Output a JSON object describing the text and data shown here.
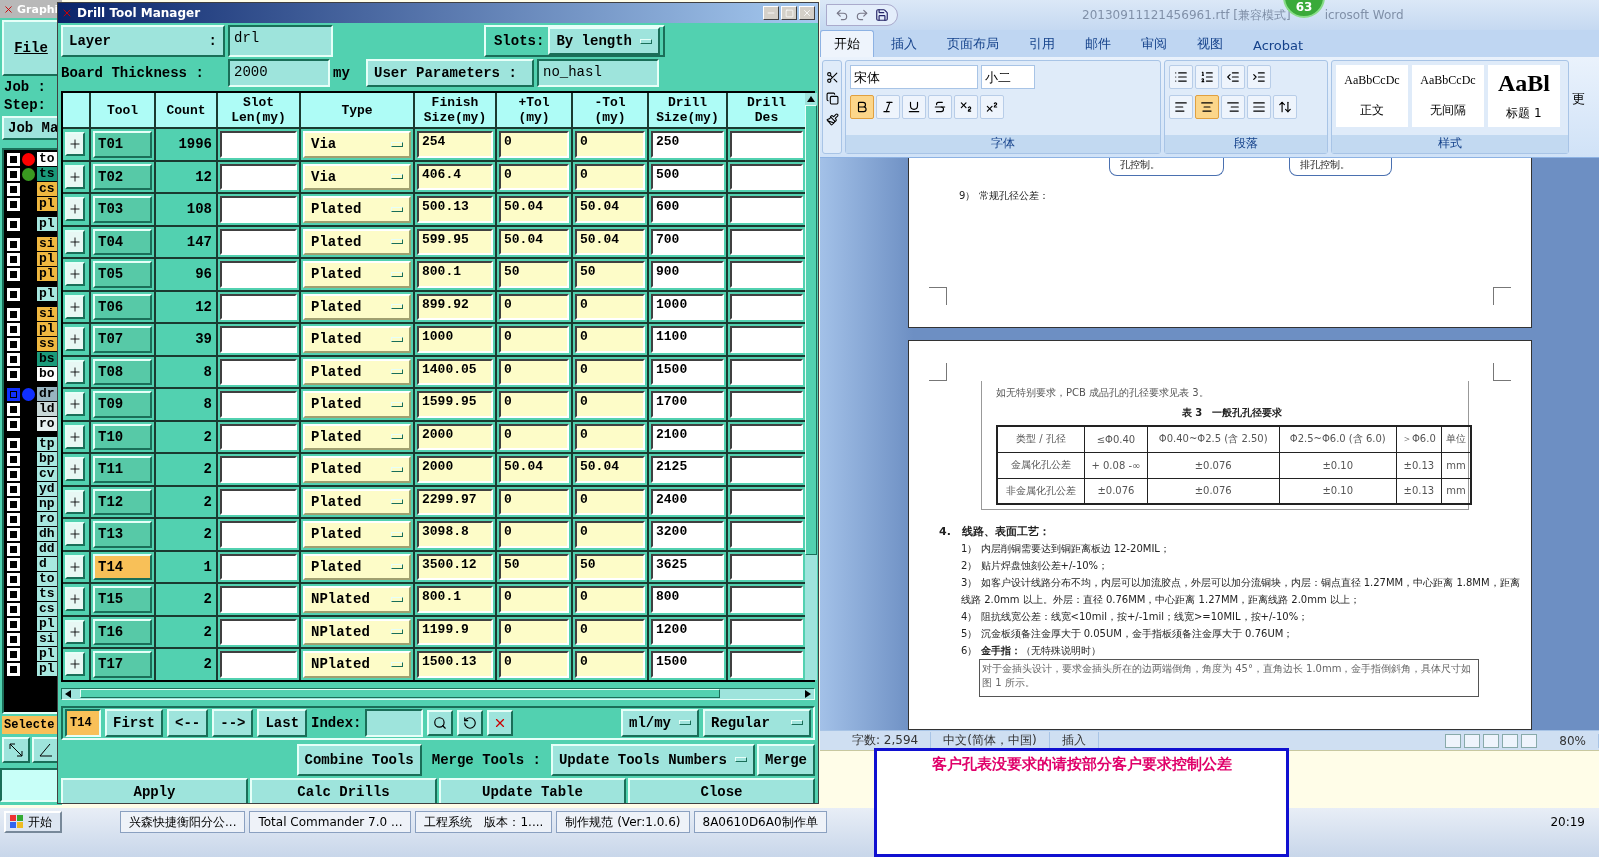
{
  "genesis": {
    "title": "Graphi",
    "menu": "File",
    "job_label": "Job :",
    "step_label": "Step:",
    "job_button": "Job Ma",
    "layer_groups": [
      {
        "layers": [
          {
            "name": "to",
            "color": "#ffffff",
            "dot": {
              "color": "#ff0000"
            },
            "selected": false
          },
          {
            "name": "ts",
            "color": "#1a9a7a",
            "dot": {
              "color": "#3a9a20"
            },
            "selected": false
          },
          {
            "name": "cs",
            "color": "#f0b840",
            "selected": false
          },
          {
            "name": "pl",
            "color": "#f0b840",
            "selected": false
          }
        ]
      },
      {
        "layers": [
          {
            "name": "pl",
            "color": "#a8e8e0",
            "selected": false
          }
        ]
      },
      {
        "layers": [
          {
            "name": "si",
            "color": "#f0b840",
            "selected": false
          },
          {
            "name": "pl",
            "color": "#f0b840",
            "selected": false
          },
          {
            "name": "pl",
            "color": "#f0b840",
            "selected": false
          }
        ]
      },
      {
        "layers": [
          {
            "name": "pl",
            "color": "#a8e8e0",
            "selected": false
          }
        ]
      },
      {
        "layers": [
          {
            "name": "si",
            "color": "#f0b840",
            "selected": false
          },
          {
            "name": "pl",
            "color": "#f0b840",
            "selected": false
          },
          {
            "name": "ss",
            "color": "#f0b840",
            "selected": false
          },
          {
            "name": "bs",
            "color": "#1a9a7a",
            "selected": false
          },
          {
            "name": "bo",
            "color": "#ffffff",
            "selected": false
          }
        ]
      },
      {
        "layers": [
          {
            "name": "dr",
            "color": "#98b4c0",
            "dot": {
              "color": "#1030ff"
            },
            "selected": true
          },
          {
            "name": "ld",
            "color": "#c8d8d8",
            "selected": false
          },
          {
            "name": "ro",
            "color": "#e8f0f0",
            "selected": false
          }
        ]
      },
      {
        "layers": [
          {
            "name": "tp",
            "color": "#a8e8e0",
            "selected": false
          },
          {
            "name": "bp",
            "color": "#a8e8e0",
            "selected": false
          },
          {
            "name": "cv",
            "color": "#a8e8e0",
            "selected": false
          },
          {
            "name": "yd",
            "color": "#a8e8e0",
            "selected": false
          },
          {
            "name": "np",
            "color": "#a8e8e0",
            "selected": false
          },
          {
            "name": "ro",
            "color": "#a8e8e0",
            "selected": false
          },
          {
            "name": "dh",
            "color": "#a8e8e0",
            "selected": false
          },
          {
            "name": "dd",
            "color": "#a8e8e0",
            "selected": false
          },
          {
            "name": "d",
            "color": "#a8e8e0",
            "selected": false
          },
          {
            "name": "to",
            "color": "#a8e8e0",
            "selected": false
          },
          {
            "name": "ts",
            "color": "#a8e8e0",
            "selected": false
          },
          {
            "name": "cs",
            "color": "#a8e8e0",
            "selected": false
          },
          {
            "name": "pl",
            "color": "#a8e8e0",
            "selected": false
          },
          {
            "name": "si",
            "color": "#a8e8e0",
            "selected": false
          },
          {
            "name": "pl",
            "color": "#a8e8e0",
            "selected": false
          },
          {
            "name": "pl",
            "color": "#a8e8e0",
            "selected": false
          }
        ]
      }
    ],
    "selected_label": "Selecte"
  },
  "drill_manager": {
    "title": "Drill Tool Manager",
    "layer_label": "Layer",
    "layer_colon": ":",
    "layer_value": "drl",
    "slots_label": "Slots:",
    "slots_value": "By length",
    "thickness_label": "Board Thickness :",
    "thickness_value": "2000",
    "thickness_unit": "my",
    "user_params_label": "User Parameters :",
    "user_params_value": "no_hasl",
    "columns": [
      "Tool",
      "Count",
      "Slot Len(my)",
      "Type",
      "Finish Size(my)",
      "+Tol (my)",
      "-Tol (my)",
      "Drill Size(my)",
      "Drill Des"
    ],
    "rows": [
      {
        "tool": "T01",
        "count": "1996",
        "type": "Via",
        "finish": "254",
        "plus_tol": "0",
        "minus_tol": "0",
        "drill_size": "250",
        "selected": false
      },
      {
        "tool": "T02",
        "count": "12",
        "type": "Via",
        "finish": "406.4",
        "plus_tol": "0",
        "minus_tol": "0",
        "drill_size": "500",
        "selected": false
      },
      {
        "tool": "T03",
        "count": "108",
        "type": "Plated",
        "finish": "500.13",
        "plus_tol": "50.04",
        "minus_tol": "50.04",
        "drill_size": "600",
        "selected": false
      },
      {
        "tool": "T04",
        "count": "147",
        "type": "Plated",
        "finish": "599.95",
        "plus_tol": "50.04",
        "minus_tol": "50.04",
        "drill_size": "700",
        "selected": false
      },
      {
        "tool": "T05",
        "count": "96",
        "type": "Plated",
        "finish": "800.1",
        "plus_tol": "50",
        "minus_tol": "50",
        "drill_size": "900",
        "selected": false
      },
      {
        "tool": "T06",
        "count": "12",
        "type": "Plated",
        "finish": "899.92",
        "plus_tol": "0",
        "minus_tol": "0",
        "drill_size": "1000",
        "selected": false
      },
      {
        "tool": "T07",
        "count": "39",
        "type": "Plated",
        "finish": "1000",
        "plus_tol": "0",
        "minus_tol": "0",
        "drill_size": "1100",
        "selected": false
      },
      {
        "tool": "T08",
        "count": "8",
        "type": "Plated",
        "finish": "1400.05",
        "plus_tol": "0",
        "minus_tol": "0",
        "drill_size": "1500",
        "selected": false
      },
      {
        "tool": "T09",
        "count": "8",
        "type": "Plated",
        "finish": "1599.95",
        "plus_tol": "0",
        "minus_tol": "0",
        "drill_size": "1700",
        "selected": false
      },
      {
        "tool": "T10",
        "count": "2",
        "type": "Plated",
        "finish": "2000",
        "plus_tol": "0",
        "minus_tol": "0",
        "drill_size": "2100",
        "selected": false
      },
      {
        "tool": "T11",
        "count": "2",
        "type": "Plated",
        "finish": "2000",
        "plus_tol": "50.04",
        "minus_tol": "50.04",
        "drill_size": "2125",
        "selected": false
      },
      {
        "tool": "T12",
        "count": "2",
        "type": "Plated",
        "finish": "2299.97",
        "plus_tol": "0",
        "minus_tol": "0",
        "drill_size": "2400",
        "selected": false
      },
      {
        "tool": "T13",
        "count": "2",
        "type": "Plated",
        "finish": "3098.8",
        "plus_tol": "0",
        "minus_tol": "0",
        "drill_size": "3200",
        "selected": false
      },
      {
        "tool": "T14",
        "count": "1",
        "type": "Plated",
        "finish": "3500.12",
        "plus_tol": "50",
        "minus_tol": "50",
        "drill_size": "3625",
        "selected": true
      },
      {
        "tool": "T15",
        "count": "2",
        "type": "NPlated",
        "finish": "800.1",
        "plus_tol": "0",
        "minus_tol": "0",
        "drill_size": "800",
        "selected": false
      },
      {
        "tool": "T16",
        "count": "2",
        "type": "NPlated",
        "finish": "1199.9",
        "plus_tol": "0",
        "minus_tol": "0",
        "drill_size": "1200",
        "selected": false
      },
      {
        "tool": "T17",
        "count": "2",
        "type": "NPlated",
        "finish": "1500.13",
        "plus_tol": "0",
        "minus_tol": "0",
        "drill_size": "1500",
        "selected": false
      }
    ],
    "current_tool": "T14",
    "nav_buttons": [
      "First",
      "<--",
      "-->",
      "Last"
    ],
    "index_label": "Index:",
    "units": "ml/my",
    "mode": "Regular",
    "combine_button": "Combine Tools",
    "merge_label": "Merge Tools :",
    "merge_value": "Update Tools Numbers",
    "merge_button": "Merge",
    "actions": [
      "Apply",
      "Calc Drills",
      "Update Table",
      "Close"
    ]
  },
  "word": {
    "title": "20130911121456961.rtf [兼容模式]",
    "title_tail": "icrosoft Word",
    "badge": "63",
    "tabs": [
      {
        "label": "开始",
        "selected": true
      },
      {
        "label": "插入",
        "selected": false
      },
      {
        "label": "页面布局",
        "selected": false
      },
      {
        "label": "引用",
        "selected": false
      },
      {
        "label": "邮件",
        "selected": false
      },
      {
        "label": "审阅",
        "selected": false
      },
      {
        "label": "视图",
        "selected": false
      },
      {
        "label": "Acrobat",
        "selected": false
      }
    ],
    "font": "宋体",
    "font_size": "小二",
    "format_buttons": [
      {
        "kind": "bold",
        "on": true
      },
      {
        "kind": "italic",
        "on": false
      },
      {
        "kind": "underline",
        "on": false
      },
      {
        "kind": "strike",
        "on": false
      },
      {
        "kind": "sub",
        "on": false
      },
      {
        "kind": "sup",
        "on": false
      }
    ],
    "align_buttons": [
      {
        "kind": "left",
        "on": false
      },
      {
        "kind": "center",
        "on": true
      },
      {
        "kind": "right",
        "on": false
      },
      {
        "kind": "justify",
        "on": false
      }
    ],
    "groups": [
      "字体",
      "段落",
      "样式"
    ],
    "styles": [
      {
        "sample": "AaBbCcDc",
        "name": "正文",
        "kind": "normal",
        "selected": false
      },
      {
        "sample": "AaBbCcDc",
        "name": "无间隔",
        "kind": "normal",
        "selected": false
      },
      {
        "sample": "AaBl",
        "name": "标题 1",
        "kind": "heading",
        "selected": false
      }
    ],
    "more_styles": "更",
    "page1": {
      "boxes": [
        "孔控制。",
        "排孔控制。"
      ],
      "item": "9） 常规孔径公差："
    },
    "page2": {
      "intro": "如无特别要求，PCB 成品孔的孔径要求见表 3。",
      "table_title": "表 3　一般孔孔径要求",
      "table": [
        [
          "类型 / 孔径",
          "≤Φ0.40",
          "Φ0.40~Φ2.5 (含 2.50)",
          "Φ2.5~Φ6.0 (含 6.0)",
          "＞Φ6.0",
          "单位"
        ],
        [
          "金属化孔公差",
          "+ 0.08 -∞",
          "±0.076",
          "±0.10",
          "±0.13",
          "mm"
        ],
        [
          "非金属化孔公差",
          "±0.076",
          "±0.076",
          "±0.10",
          "±0.13",
          "mm"
        ]
      ],
      "heading": "4.　线路、表面工艺：",
      "items": [
        "1） 内层削铜需要达到铜距离板边 12-20MIL；",
        "2） 贴片焊盘蚀刻公差+/-10%；",
        "3） 如客户设计线路分布不均，内层可以加流胶点，外层可以加分流铜块，内层：铜点直径 1.27MM，中心距离 1.8MM，距离线路 2.0mm 以上。外层：直径 0.76MM，中心距离 1.27MM，距离线路 2.0mm 以上；",
        "4） 阻抗线宽公差：线宽<10mil，按+/-1mil；线宽>=10MIL，按+/-10%；",
        "5） 沉金板须备注金厚大于 0.05UM，金手指板须备注金厚大于 0.76UM；",
        "6） **金手指：**（无特殊说明时）"
      ],
      "note": "对于金插头设计，要求金插头所在的边两端倒角，角度为 45°，直角边长 1.0mm，金手指倒斜角，具体尺寸如图 1 所示。"
    },
    "status": {
      "words": "字数: 2,594",
      "language": "中文(简体，中国)",
      "mode": "插入",
      "zoom": "80%"
    }
  },
  "popup": {
    "text": "客户孔表没要求的请按部分客户要求控制公差"
  },
  "taskbar": {
    "start": "开始",
    "tasks": [
      "兴森快捷衡阳分公...",
      "Total Commander 7.0 ...",
      "工程系统　版本：1....",
      "制作规范 (Ver:1.0.6)",
      "8A0610D6A0制作单"
    ],
    "clock": "20:19"
  }
}
